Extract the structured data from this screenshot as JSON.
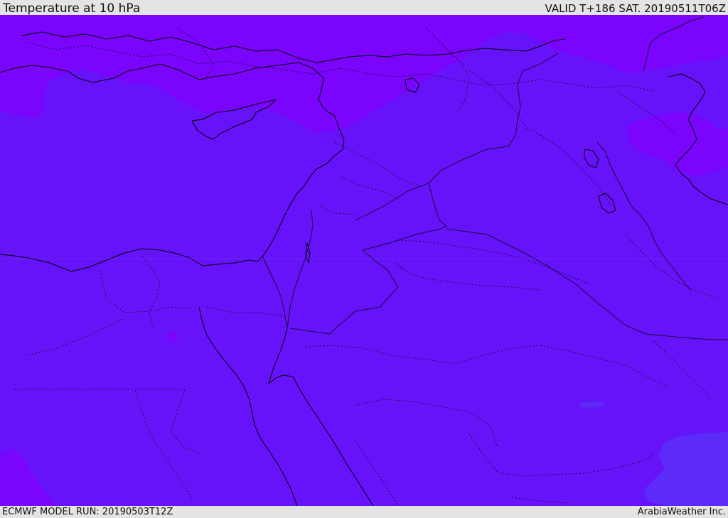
{
  "header": {
    "title": "Temperature at 10 hPa",
    "valid_time": "VALID T+186 SAT. 20190511T06Z"
  },
  "footer": {
    "model_run": "ECMWF MODEL RUN: 20190503T12Z",
    "credit": "ArabiaWeather Inc."
  },
  "map": {
    "region": "Eastern Mediterranean and Middle East",
    "colors": {
      "base_field": "#6613fa",
      "cold_field": "#7a04fc",
      "warm_field": "#5c2bf8",
      "coastline": "#000000",
      "border": "#1a0a3a"
    }
  }
}
